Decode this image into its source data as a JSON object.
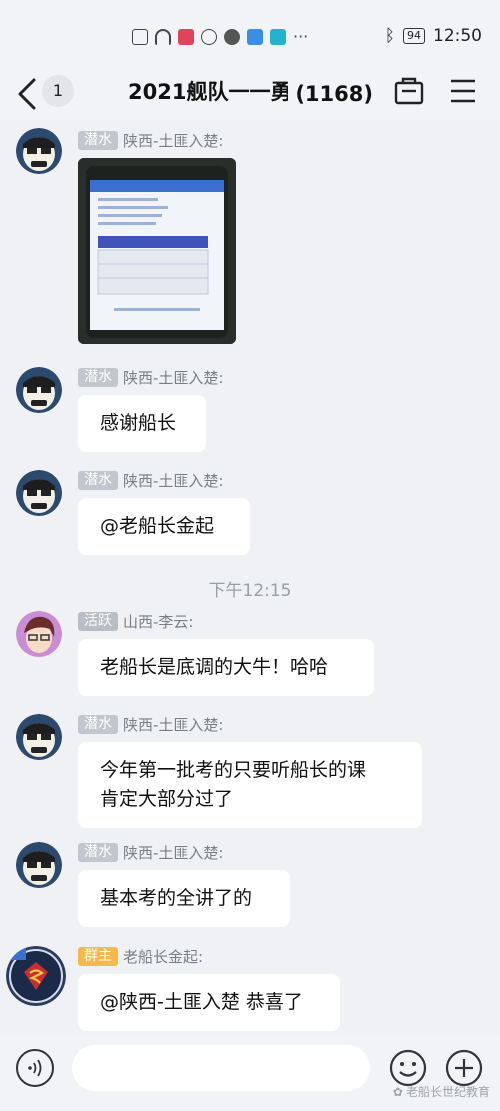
{
  "status_bar": {
    "time": "12:50",
    "battery": "94"
  },
  "header": {
    "unread_count": "1",
    "title_name": "2021舰队一一勇",
    "title_count": "(1168)"
  },
  "messages": [
    {
      "badge": "潜水",
      "sender": "陕西-土匪入楚:",
      "type": "image"
    },
    {
      "badge": "潜水",
      "sender": "陕西-土匪入楚:",
      "text": "感谢船长"
    },
    {
      "badge": "潜水",
      "sender": "陕西-土匪入楚:",
      "text": "@老船长金起"
    },
    {
      "badge": "活跃",
      "sender": "山西-李云:",
      "text": "老船长是底调的大牛！哈哈"
    },
    {
      "badge": "潜水",
      "sender": "陕西-土匪入楚:",
      "lines": [
        "今年第一批考的只要听船长的课",
        "肯定大部分过了"
      ]
    },
    {
      "badge": "潜水",
      "sender": "陕西-土匪入楚:",
      "text": "基本考的全讲了的"
    },
    {
      "badge": "群主",
      "sender": "老船长金起:",
      "text": "@陕西-土匪入楚 恭喜了"
    }
  ],
  "time_separator": "下午12:15",
  "watermark": "老船长世纪教育",
  "colors": {
    "background": "#eff1f5",
    "bubble": "#ffffff",
    "owner_badge": "#f5b94a",
    "member_badge": "#c3c7cd"
  },
  "icons": [
    "back-icon",
    "bag-icon",
    "menu-icon",
    "voice-icon",
    "emoji-icon",
    "plus-icon"
  ]
}
